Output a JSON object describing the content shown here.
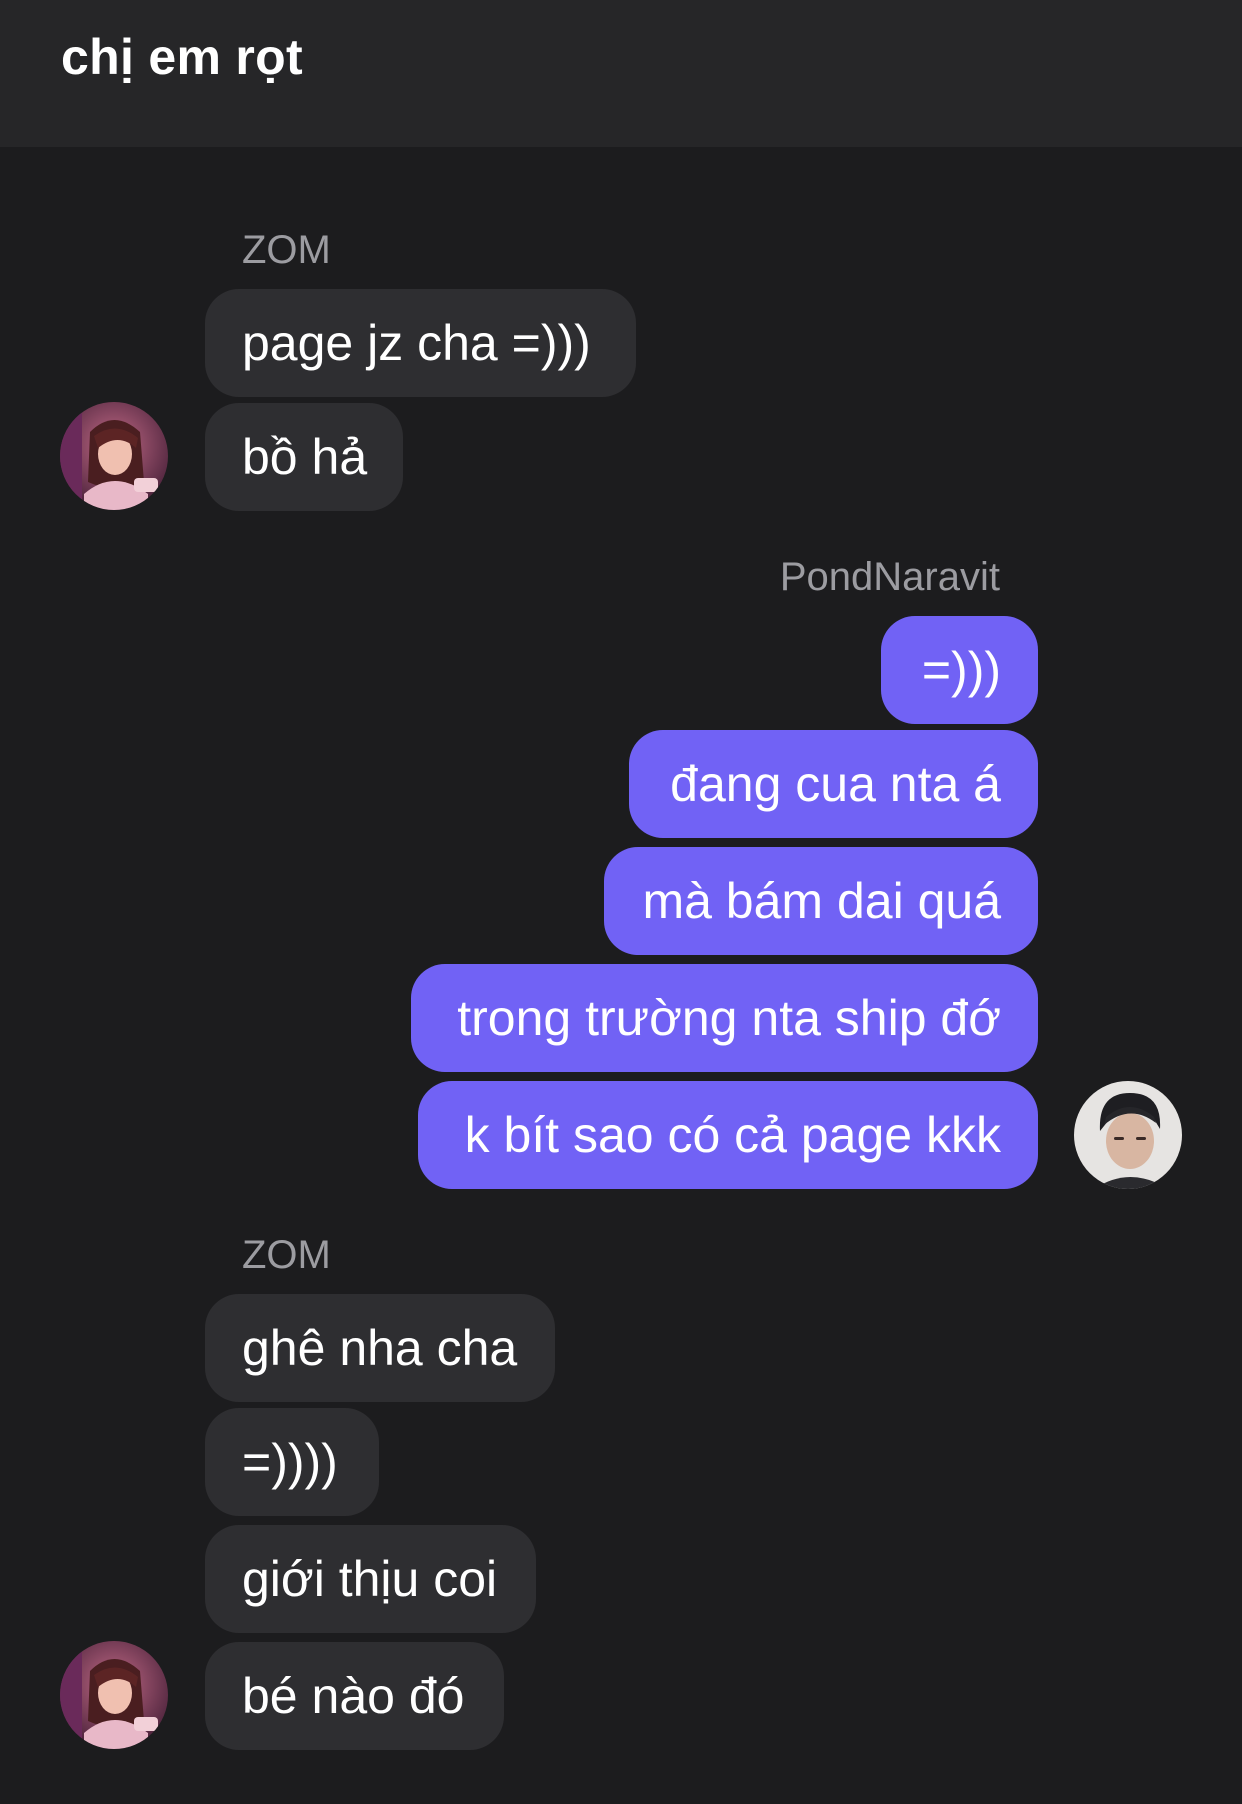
{
  "header": {
    "title": "chị em rọt"
  },
  "groups": [
    {
      "sender": "ZOM",
      "messages": [
        "page jz cha =)))",
        "bồ hả"
      ]
    },
    {
      "sender": "PondNaravit",
      "messages": [
        "=)))",
        "đang cua nta á",
        "mà bám dai quá",
        "trong trường nta ship đớ",
        "k bít sao có cả page kkk"
      ]
    },
    {
      "sender": "ZOM",
      "messages": [
        "ghê nha cha",
        "=))))",
        "giới thịu coi",
        "bé nào đó"
      ]
    }
  ],
  "colors": {
    "background": "#1c1c1e",
    "header": "#262628",
    "incoming_bubble": "#2e2e31",
    "outgoing_bubble": "#7162f5",
    "sender_name": "#9c9ca1"
  },
  "icons": {
    "zom_avatar": "avatar-photo-woman",
    "pond_avatar": "avatar-photo-man"
  }
}
